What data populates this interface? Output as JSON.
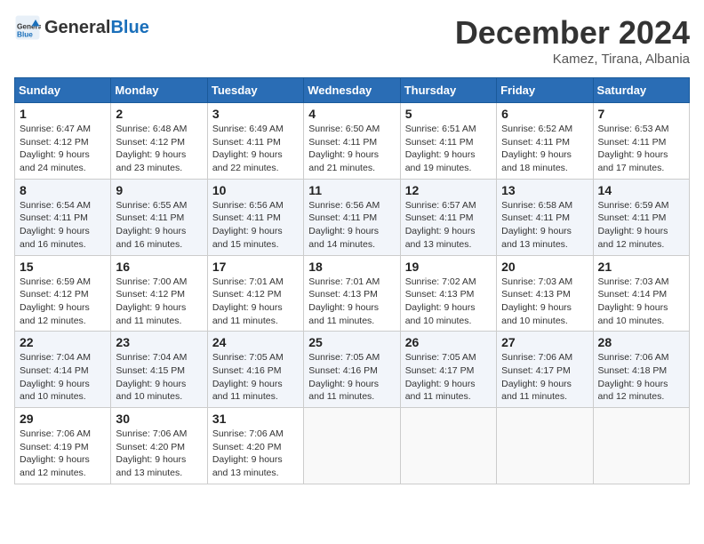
{
  "logo": {
    "text_general": "General",
    "text_blue": "Blue"
  },
  "title": "December 2024",
  "location": "Kamez, Tirana, Albania",
  "days_of_week": [
    "Sunday",
    "Monday",
    "Tuesday",
    "Wednesday",
    "Thursday",
    "Friday",
    "Saturday"
  ],
  "weeks": [
    [
      {
        "day": "1",
        "sunrise": "6:47 AM",
        "sunset": "4:12 PM",
        "daylight": "9 hours and 24 minutes."
      },
      {
        "day": "2",
        "sunrise": "6:48 AM",
        "sunset": "4:12 PM",
        "daylight": "9 hours and 23 minutes."
      },
      {
        "day": "3",
        "sunrise": "6:49 AM",
        "sunset": "4:11 PM",
        "daylight": "9 hours and 22 minutes."
      },
      {
        "day": "4",
        "sunrise": "6:50 AM",
        "sunset": "4:11 PM",
        "daylight": "9 hours and 21 minutes."
      },
      {
        "day": "5",
        "sunrise": "6:51 AM",
        "sunset": "4:11 PM",
        "daylight": "9 hours and 19 minutes."
      },
      {
        "day": "6",
        "sunrise": "6:52 AM",
        "sunset": "4:11 PM",
        "daylight": "9 hours and 18 minutes."
      },
      {
        "day": "7",
        "sunrise": "6:53 AM",
        "sunset": "4:11 PM",
        "daylight": "9 hours and 17 minutes."
      }
    ],
    [
      {
        "day": "8",
        "sunrise": "6:54 AM",
        "sunset": "4:11 PM",
        "daylight": "9 hours and 16 minutes."
      },
      {
        "day": "9",
        "sunrise": "6:55 AM",
        "sunset": "4:11 PM",
        "daylight": "9 hours and 16 minutes."
      },
      {
        "day": "10",
        "sunrise": "6:56 AM",
        "sunset": "4:11 PM",
        "daylight": "9 hours and 15 minutes."
      },
      {
        "day": "11",
        "sunrise": "6:56 AM",
        "sunset": "4:11 PM",
        "daylight": "9 hours and 14 minutes."
      },
      {
        "day": "12",
        "sunrise": "6:57 AM",
        "sunset": "4:11 PM",
        "daylight": "9 hours and 13 minutes."
      },
      {
        "day": "13",
        "sunrise": "6:58 AM",
        "sunset": "4:11 PM",
        "daylight": "9 hours and 13 minutes."
      },
      {
        "day": "14",
        "sunrise": "6:59 AM",
        "sunset": "4:11 PM",
        "daylight": "9 hours and 12 minutes."
      }
    ],
    [
      {
        "day": "15",
        "sunrise": "6:59 AM",
        "sunset": "4:12 PM",
        "daylight": "9 hours and 12 minutes."
      },
      {
        "day": "16",
        "sunrise": "7:00 AM",
        "sunset": "4:12 PM",
        "daylight": "9 hours and 11 minutes."
      },
      {
        "day": "17",
        "sunrise": "7:01 AM",
        "sunset": "4:12 PM",
        "daylight": "9 hours and 11 minutes."
      },
      {
        "day": "18",
        "sunrise": "7:01 AM",
        "sunset": "4:13 PM",
        "daylight": "9 hours and 11 minutes."
      },
      {
        "day": "19",
        "sunrise": "7:02 AM",
        "sunset": "4:13 PM",
        "daylight": "9 hours and 10 minutes."
      },
      {
        "day": "20",
        "sunrise": "7:03 AM",
        "sunset": "4:13 PM",
        "daylight": "9 hours and 10 minutes."
      },
      {
        "day": "21",
        "sunrise": "7:03 AM",
        "sunset": "4:14 PM",
        "daylight": "9 hours and 10 minutes."
      }
    ],
    [
      {
        "day": "22",
        "sunrise": "7:04 AM",
        "sunset": "4:14 PM",
        "daylight": "9 hours and 10 minutes."
      },
      {
        "day": "23",
        "sunrise": "7:04 AM",
        "sunset": "4:15 PM",
        "daylight": "9 hours and 10 minutes."
      },
      {
        "day": "24",
        "sunrise": "7:05 AM",
        "sunset": "4:16 PM",
        "daylight": "9 hours and 11 minutes."
      },
      {
        "day": "25",
        "sunrise": "7:05 AM",
        "sunset": "4:16 PM",
        "daylight": "9 hours and 11 minutes."
      },
      {
        "day": "26",
        "sunrise": "7:05 AM",
        "sunset": "4:17 PM",
        "daylight": "9 hours and 11 minutes."
      },
      {
        "day": "27",
        "sunrise": "7:06 AM",
        "sunset": "4:17 PM",
        "daylight": "9 hours and 11 minutes."
      },
      {
        "day": "28",
        "sunrise": "7:06 AM",
        "sunset": "4:18 PM",
        "daylight": "9 hours and 12 minutes."
      }
    ],
    [
      {
        "day": "29",
        "sunrise": "7:06 AM",
        "sunset": "4:19 PM",
        "daylight": "9 hours and 12 minutes."
      },
      {
        "day": "30",
        "sunrise": "7:06 AM",
        "sunset": "4:20 PM",
        "daylight": "9 hours and 13 minutes."
      },
      {
        "day": "31",
        "sunrise": "7:06 AM",
        "sunset": "4:20 PM",
        "daylight": "9 hours and 13 minutes."
      },
      null,
      null,
      null,
      null
    ]
  ]
}
